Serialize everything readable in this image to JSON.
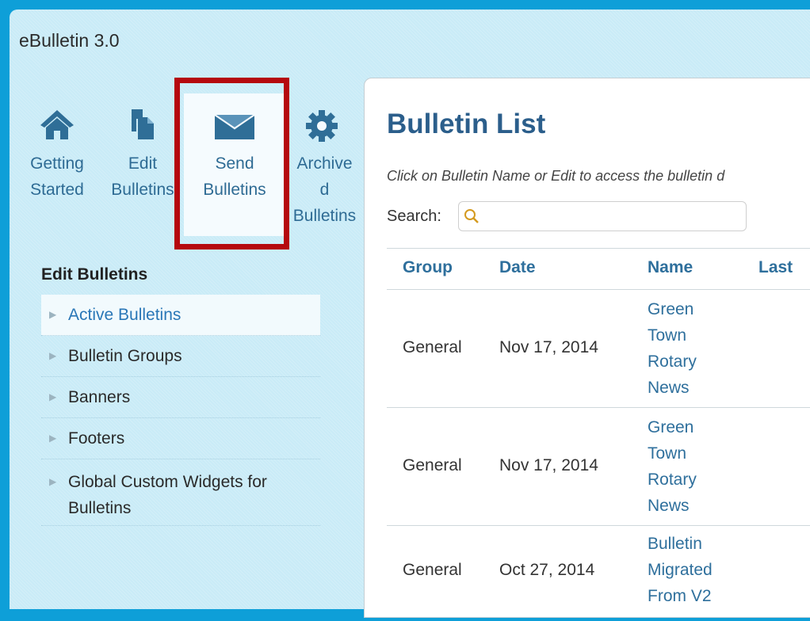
{
  "app": {
    "title": "eBulletin 3.0"
  },
  "toolbar": {
    "items": [
      {
        "label": "Getting\nStarted",
        "icon": "home-icon"
      },
      {
        "label": "Edit\nBulletins",
        "icon": "documents-icon"
      },
      {
        "label": "Send\nBulletins",
        "icon": "envelope-icon"
      },
      {
        "label": "Archive\nd\nBulletins",
        "icon": "gear-icon"
      }
    ]
  },
  "sidebar": {
    "heading": "Edit Bulletins",
    "items": [
      {
        "label": "Active Bulletins"
      },
      {
        "label": "Bulletin Groups"
      },
      {
        "label": "Banners"
      },
      {
        "label": "Footers"
      },
      {
        "label": "Global Custom Widgets for Bulletins"
      }
    ]
  },
  "main": {
    "title": "Bulletin List",
    "instructions": "Click on Bulletin Name or Edit to access the bulletin d",
    "search": {
      "label": "Search:",
      "value": "",
      "placeholder": ""
    },
    "table": {
      "columns": [
        "Group",
        "Date",
        "Name",
        "Last"
      ],
      "rows": [
        {
          "group": "General",
          "date": "Nov 17, 2014",
          "name": "Green\nTown\nRotary\nNews"
        },
        {
          "group": "General",
          "date": "Nov 17, 2014",
          "name": "Green\nTown\nRotary\nNews"
        },
        {
          "group": "General",
          "date": "Oct 27, 2014",
          "name": "Bulletin\nMigrated\nFrom V2"
        }
      ]
    }
  },
  "colors": {
    "frame": "#0e9fd8",
    "panel": "#c9ebf7",
    "accent": "#2e6f9c",
    "highlight": "#b5080e"
  }
}
